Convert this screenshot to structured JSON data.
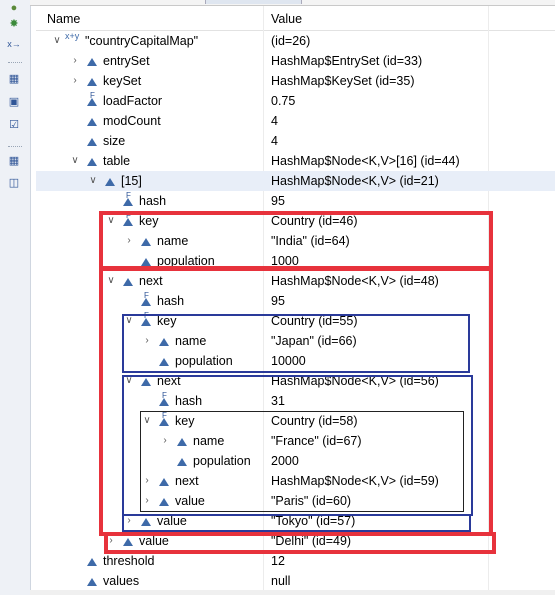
{
  "header": {
    "name_label": "Name",
    "value_label": "Value"
  },
  "rows": [
    {
      "name": "\"countryCapitalMap\"",
      "value": " (id=26)",
      "icon": "map-icon",
      "toggle": "expanded",
      "selected": false
    },
    {
      "name": "entrySet",
      "value": "HashMap$EntrySet  (id=33)",
      "icon": "field-icon",
      "toggle": "collapsed",
      "selected": false
    },
    {
      "name": "keySet",
      "value": "HashMap$KeySet  (id=35)",
      "icon": "field-icon",
      "toggle": "collapsed",
      "selected": false
    },
    {
      "name": "loadFactor",
      "value": "0.75",
      "icon": "final-field-icon",
      "toggle": "none",
      "selected": false
    },
    {
      "name": "modCount",
      "value": "4",
      "icon": "field-icon",
      "toggle": "none",
      "selected": false
    },
    {
      "name": "size",
      "value": "4",
      "icon": "field-icon",
      "toggle": "none",
      "selected": false
    },
    {
      "name": "table",
      "value": "HashMap$Node<K,V>[16]  (id=44)",
      "icon": "field-icon",
      "toggle": "expanded",
      "selected": false
    },
    {
      "name": "[15]",
      "value": "HashMap$Node<K,V>  (id=21)",
      "icon": "field-icon",
      "toggle": "expanded",
      "selected": true
    },
    {
      "name": "hash",
      "value": "95",
      "icon": "final-field-icon",
      "toggle": "none",
      "selected": false
    },
    {
      "name": "key",
      "value": "Country  (id=46)",
      "icon": "final-field-icon",
      "toggle": "expanded",
      "selected": false
    },
    {
      "name": "name",
      "value": "\"India\" (id=64)",
      "icon": "field-icon",
      "toggle": "collapsed",
      "selected": false
    },
    {
      "name": "population",
      "value": "1000",
      "icon": "field-icon",
      "toggle": "none",
      "selected": false
    },
    {
      "name": "next",
      "value": "HashMap$Node<K,V>  (id=48)",
      "icon": "field-icon",
      "toggle": "expanded",
      "selected": false
    },
    {
      "name": "hash",
      "value": "95",
      "icon": "final-field-icon",
      "toggle": "none",
      "selected": false
    },
    {
      "name": "key",
      "value": "Country  (id=55)",
      "icon": "final-field-icon",
      "toggle": "expanded",
      "selected": false
    },
    {
      "name": "name",
      "value": "\"Japan\" (id=66)",
      "icon": "field-icon",
      "toggle": "collapsed",
      "selected": false
    },
    {
      "name": "population",
      "value": "10000",
      "icon": "field-icon",
      "toggle": "none",
      "selected": false
    },
    {
      "name": "next",
      "value": "HashMap$Node<K,V>  (id=56)",
      "icon": "field-icon",
      "toggle": "expanded",
      "selected": false
    },
    {
      "name": "hash",
      "value": "31",
      "icon": "final-field-icon",
      "toggle": "none",
      "selected": false
    },
    {
      "name": "key",
      "value": "Country  (id=58)",
      "icon": "final-field-icon",
      "toggle": "expanded",
      "selected": false
    },
    {
      "name": "name",
      "value": "\"France\" (id=67)",
      "icon": "field-icon",
      "toggle": "collapsed",
      "selected": false
    },
    {
      "name": "population",
      "value": "2000",
      "icon": "field-icon",
      "toggle": "none",
      "selected": false
    },
    {
      "name": "next",
      "value": "HashMap$Node<K,V>  (id=59)",
      "icon": "field-icon",
      "toggle": "collapsed",
      "selected": false
    },
    {
      "name": "value",
      "value": "\"Paris\" (id=60)",
      "icon": "field-icon",
      "toggle": "collapsed",
      "selected": false
    },
    {
      "name": "value",
      "value": "\"Tokyo\" (id=57)",
      "icon": "field-icon",
      "toggle": "collapsed",
      "selected": false
    },
    {
      "name": "value",
      "value": "\"Delhi\" (id=49)",
      "icon": "field-icon",
      "toggle": "collapsed",
      "selected": false
    },
    {
      "name": "threshold",
      "value": "12",
      "icon": "field-icon",
      "toggle": "none",
      "selected": false
    },
    {
      "name": "values",
      "value": "null",
      "icon": "field-icon",
      "toggle": "none",
      "selected": false
    }
  ],
  "colors": {
    "highlight_red": "#e7323c",
    "highlight_blue": "#2a3a9a",
    "highlight_black": "#222222",
    "field_icon": "#3e6aa8",
    "selection": "#e8eef8"
  },
  "toolbar": {
    "icons": [
      "breakpoint-icon",
      "debug-target-icon",
      "expressions-icon",
      "collapse-icon",
      "display-icon",
      "checklist-icon",
      "collapse-all-icon",
      "layout-icon"
    ]
  }
}
